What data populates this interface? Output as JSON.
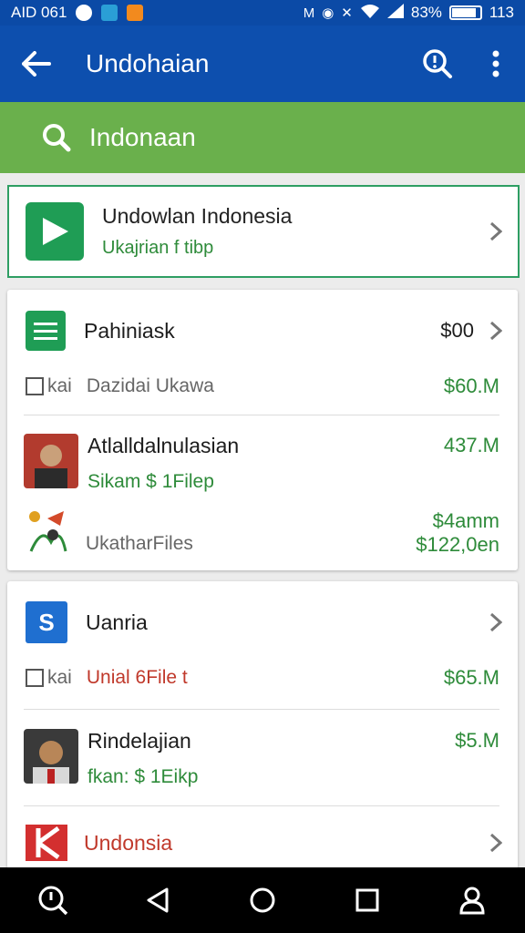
{
  "status_bar": {
    "left_text": "AID 061",
    "percent": "83%",
    "time": "113",
    "icons": [
      "cat-icon",
      "music-icon",
      "orange-app-icon",
      "mute-icon",
      "alarm-icon",
      "vibrate-icon",
      "wifi-icon",
      "signal-icon",
      "battery-icon"
    ]
  },
  "app_bar": {
    "title": "Undohaian",
    "icons": [
      "back-arrow-icon",
      "search-icon",
      "more-vert-icon"
    ]
  },
  "search": {
    "text": "Indonaan",
    "icon": "search-icon"
  },
  "highlight_card": {
    "title": "Undowlan Indonesia",
    "subtitle": "Ukajrian f tibp",
    "icon": "play-icon"
  },
  "card1": {
    "item1": {
      "title": "Pahiniask",
      "amount": "$00",
      "sub_label": "kai",
      "sub_text": "Dazidai Ukawa",
      "sub_amount": "$60.M"
    },
    "item2": {
      "title": "Atlalldalnulasian",
      "amount": "437.M",
      "sub_text": "Sikam $ 1Filep"
    },
    "item3": {
      "title": "UkatharFiles",
      "amount1": "$4amm",
      "amount2": "$122,0en"
    }
  },
  "card2": {
    "item1": {
      "title": "Uanria",
      "badge": "S",
      "sub_label": "kai",
      "sub_text": "Unial 6File t",
      "sub_amount": "$65.M"
    },
    "item2": {
      "title": "Rindelajian",
      "amount": "$5.M",
      "sub_text": "fkan: $ 1Eikp"
    },
    "item3": {
      "title": "Undonsia"
    }
  },
  "colors": {
    "app_bar": "#0d4fae",
    "search_bar": "#6ab04c",
    "accent_green": "#2e8b3a",
    "nav_bar": "#000000"
  },
  "nav_icons": [
    "search-history-icon",
    "back-triangle-icon",
    "home-circle-icon",
    "recents-square-icon",
    "account-icon"
  ]
}
